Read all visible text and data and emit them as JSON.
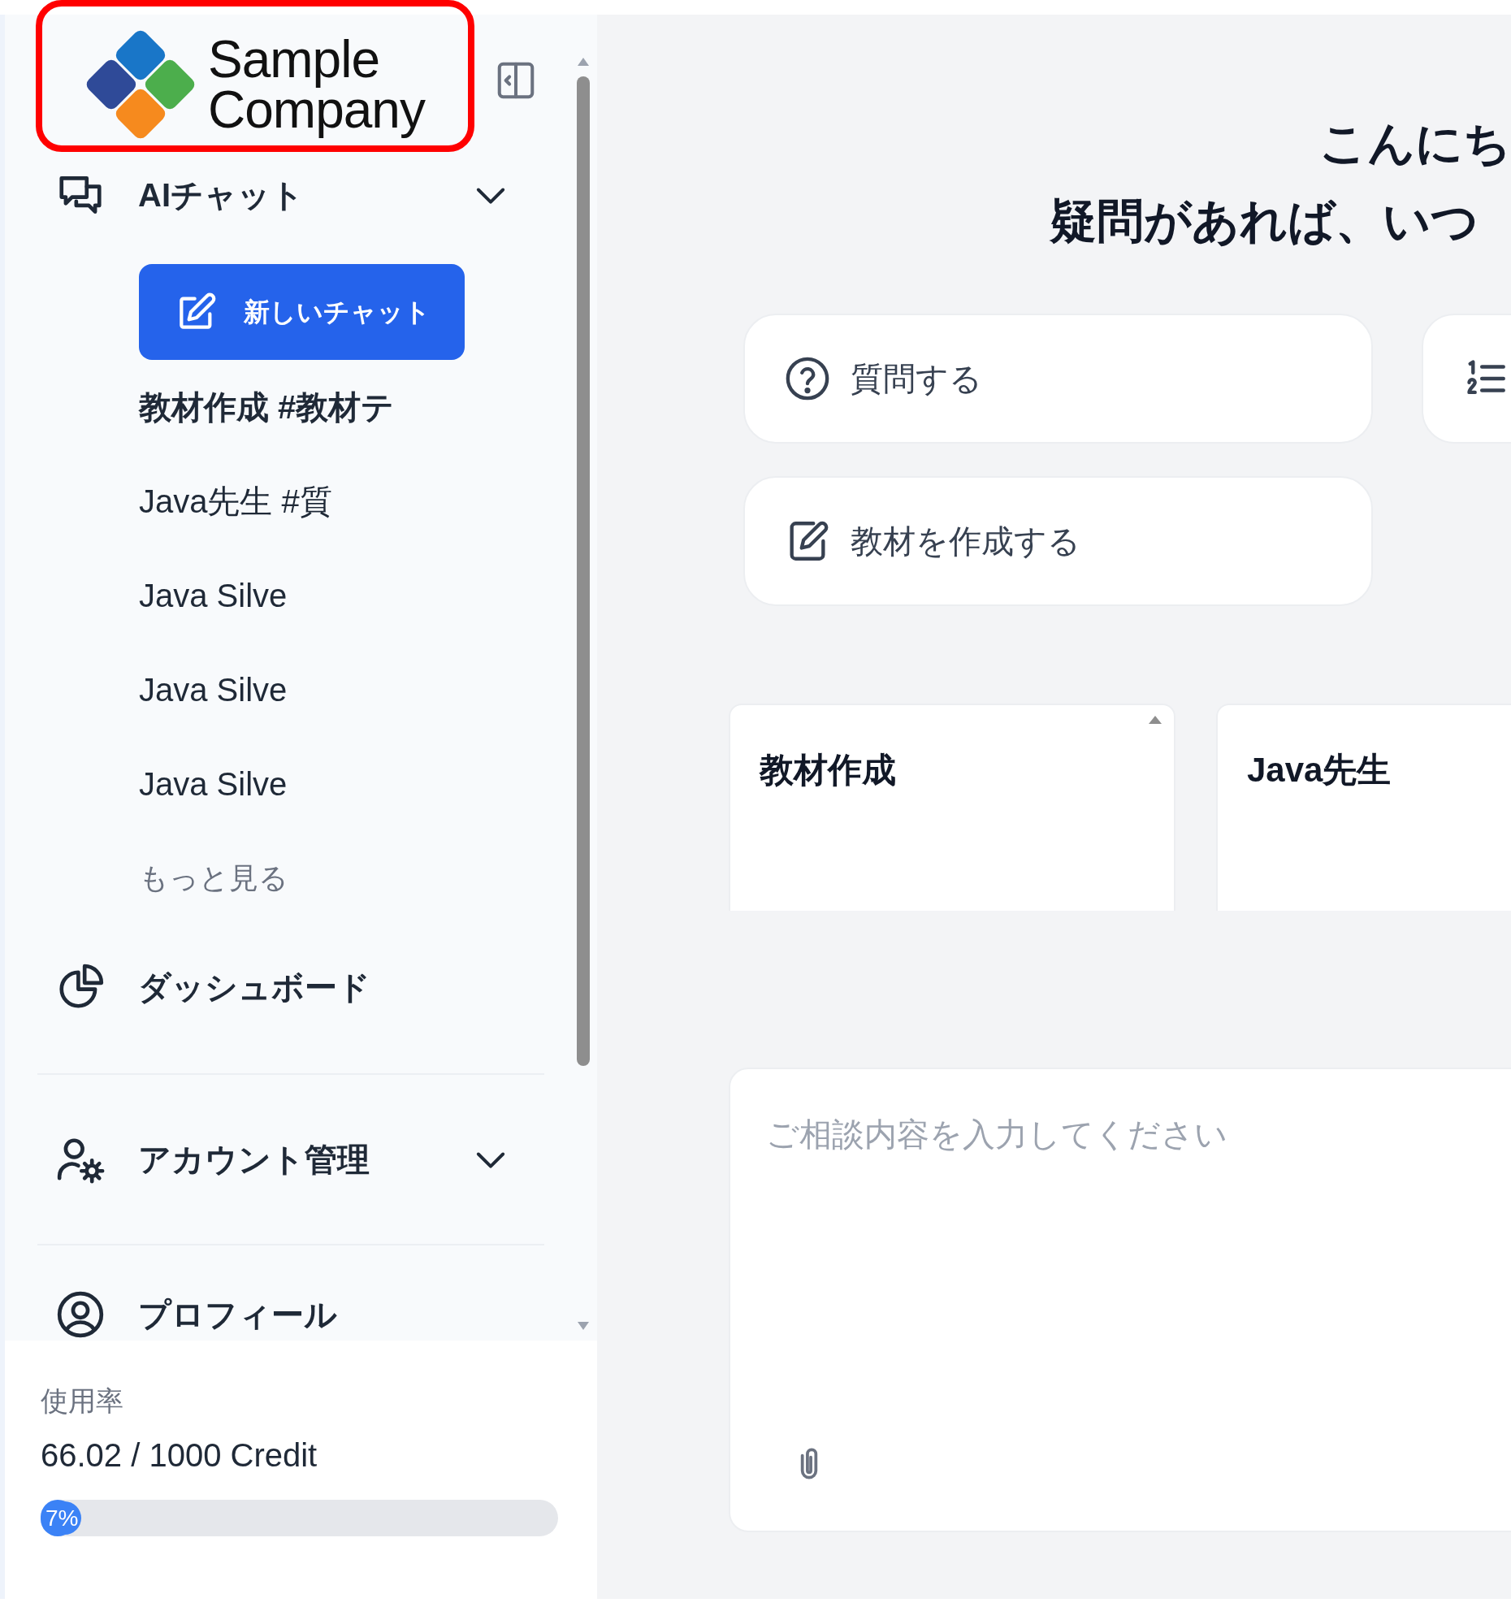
{
  "sidebar": {
    "logo": {
      "lines": [
        "Sample",
        "Company"
      ]
    },
    "ai_chat": {
      "label": "AIチャット",
      "new_chat_button": "新しいチャット",
      "history": [
        {
          "label": "教材作成 #教材テ",
          "selected": true
        },
        {
          "label": "Java先生 #質",
          "selected": false
        },
        {
          "label": "Java Silve",
          "selected": false
        },
        {
          "label": "Java Silve",
          "selected": false
        },
        {
          "label": "Java Silve",
          "selected": false
        }
      ],
      "more_link": "もっと見る"
    },
    "dashboard": {
      "label": "ダッシュボード"
    },
    "account": {
      "label": "アカウント管理"
    },
    "profile": {
      "label": "プロフィール"
    },
    "usage": {
      "label": "使用率",
      "credit": "66.02 / 1000 Credit",
      "level": 0.066,
      "percent": "7%"
    }
  },
  "main": {
    "greeting": [
      "こんにち",
      "疑問があれば、いつ"
    ],
    "suggestions": [
      {
        "kind": "question",
        "label": "質問する"
      },
      {
        "kind": "list"
      },
      {
        "kind": "edit",
        "label": "教材を作成する"
      }
    ],
    "templates": [
      {
        "title": "教材作成"
      },
      {
        "title": "Java先生"
      }
    ],
    "composer": {
      "placeholder": "ご相談内容を入力してください"
    }
  }
}
